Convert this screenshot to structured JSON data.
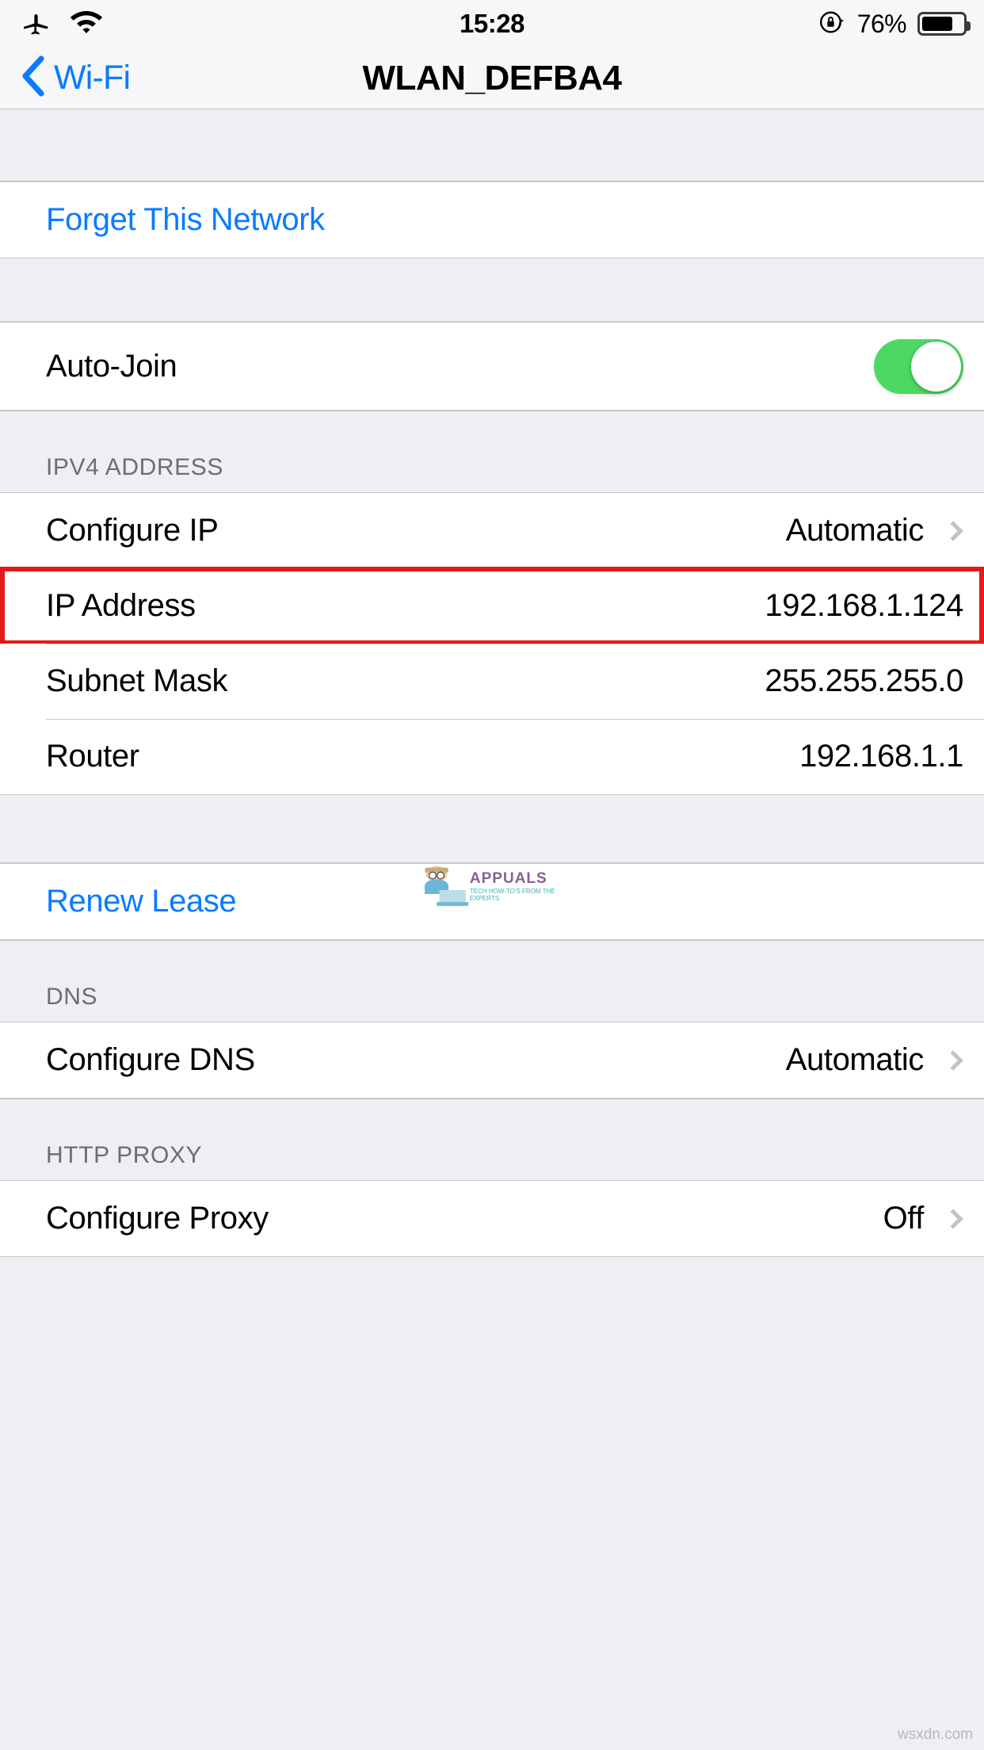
{
  "statusbar": {
    "airplane_icon": "airplane-icon",
    "wifi_icon": "wifi-icon",
    "time": "15:28",
    "rotation_lock_icon": "rotation-lock-icon",
    "battery_percent": "76%",
    "battery_level": 76
  },
  "navbar": {
    "back_label": "Wi-Fi",
    "back_icon": "chevron-left-icon",
    "title": "WLAN_DEFBA4"
  },
  "sections": {
    "forget": {
      "label": "Forget This Network"
    },
    "autojoin": {
      "label": "Auto-Join",
      "value": "On",
      "enabled": true
    },
    "ipv4": {
      "header": "IPV4 ADDRESS",
      "rows": [
        {
          "label": "Configure IP",
          "value": "Automatic",
          "chevron": true
        },
        {
          "label": "IP Address",
          "value": "192.168.1.124",
          "chevron": false
        },
        {
          "label": "Subnet Mask",
          "value": "255.255.255.0",
          "chevron": false
        },
        {
          "label": "Router",
          "value": "192.168.1.1",
          "chevron": false
        }
      ]
    },
    "renew": {
      "label": "Renew Lease"
    },
    "dns": {
      "header": "DNS",
      "rows": [
        {
          "label": "Configure DNS",
          "value": "Automatic",
          "chevron": true
        }
      ]
    },
    "proxy": {
      "header": "HTTP PROXY",
      "rows": [
        {
          "label": "Configure Proxy",
          "value": "Off",
          "chevron": true
        }
      ]
    }
  },
  "annotation": {
    "target": "IP Address",
    "color": "#E01B1B"
  },
  "watermark": {
    "brand": "APPUALS",
    "tagline": "TECH HOW-TO'S FROM THE EXPERTS",
    "corner": "wsxdn.com"
  },
  "colors": {
    "accent_blue": "#0A7BFF",
    "toggle_green": "#4CD862",
    "group_bg": "#FFFFFF",
    "page_bg": "#EFEEF3",
    "separator": "#C8C7CC",
    "header_text": "#6D6D72"
  }
}
